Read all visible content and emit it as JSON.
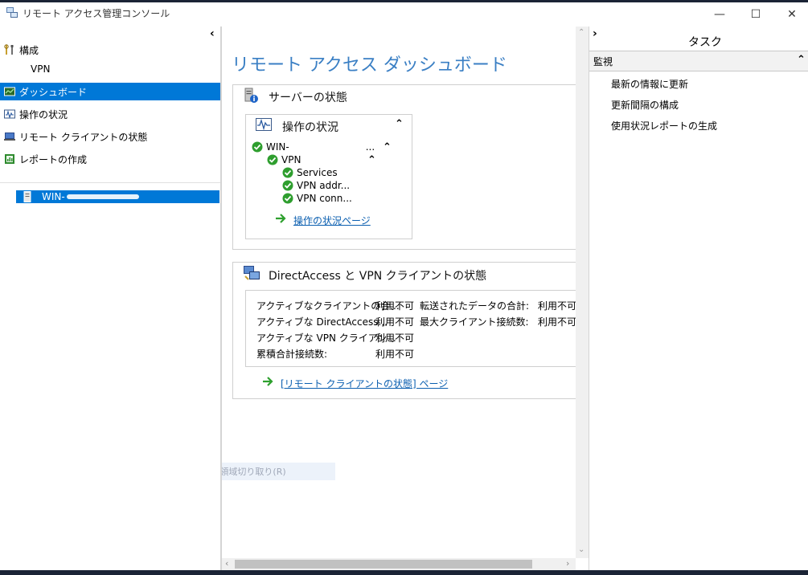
{
  "window": {
    "title": "リモート アクセス管理コンソール",
    "minimize": "—",
    "maximize": "☐",
    "close": "✕"
  },
  "left_nav": {
    "collapse": "‹",
    "config": "構成",
    "vpn": "VPN",
    "items": [
      {
        "label": "ダッシュボード",
        "icon": "dashboard-icon"
      },
      {
        "label": "操作の状況",
        "icon": "operations-status-icon"
      },
      {
        "label": "リモート クライアントの状態",
        "icon": "remote-client-icon"
      },
      {
        "label": "レポートの作成",
        "icon": "report-icon"
      }
    ],
    "server": "WIN-"
  },
  "center": {
    "title": "リモート アクセス ダッシュボード",
    "server_status": {
      "title": "サーバーの状態",
      "ops": {
        "title": "操作の状況",
        "server_name": "WIN-",
        "server_suffix": "...",
        "vpn": "VPN",
        "children": [
          "Services",
          "VPN addr...",
          "VPN conn..."
        ],
        "link": "操作の状況ページ"
      }
    },
    "client_status": {
      "title": "DirectAccess と VPN クライアントの状態",
      "stats": [
        {
          "label": "アクティブなクライアントの合...",
          "value": "利用不可"
        },
        {
          "label": "アクティブな DirectAccess...",
          "value": "利用不可"
        },
        {
          "label": "アクティブな VPN クライアン...",
          "value": "利用不可"
        },
        {
          "label": "累積合計接続数:",
          "value": "利用不可"
        }
      ],
      "stats_right": [
        {
          "label": "転送されたデータの合計:",
          "value": "利用不可"
        },
        {
          "label": "最大クライアント接続数:",
          "value": "利用不可"
        }
      ],
      "link": "[リモート クライアントの状態] ページ"
    }
  },
  "tasks": {
    "title": "タスク",
    "collapse": "›",
    "section": "監視",
    "items": [
      "最新の情報に更新",
      "更新間隔の構成",
      "使用状況レポートの生成"
    ]
  },
  "ghost_menu": "四角形の領域切り取り(R)",
  "colors": {
    "accent": "#0078d7",
    "link": "#0b5fb0",
    "title": "#3a7fc4",
    "ok": "#2e9e2e"
  }
}
